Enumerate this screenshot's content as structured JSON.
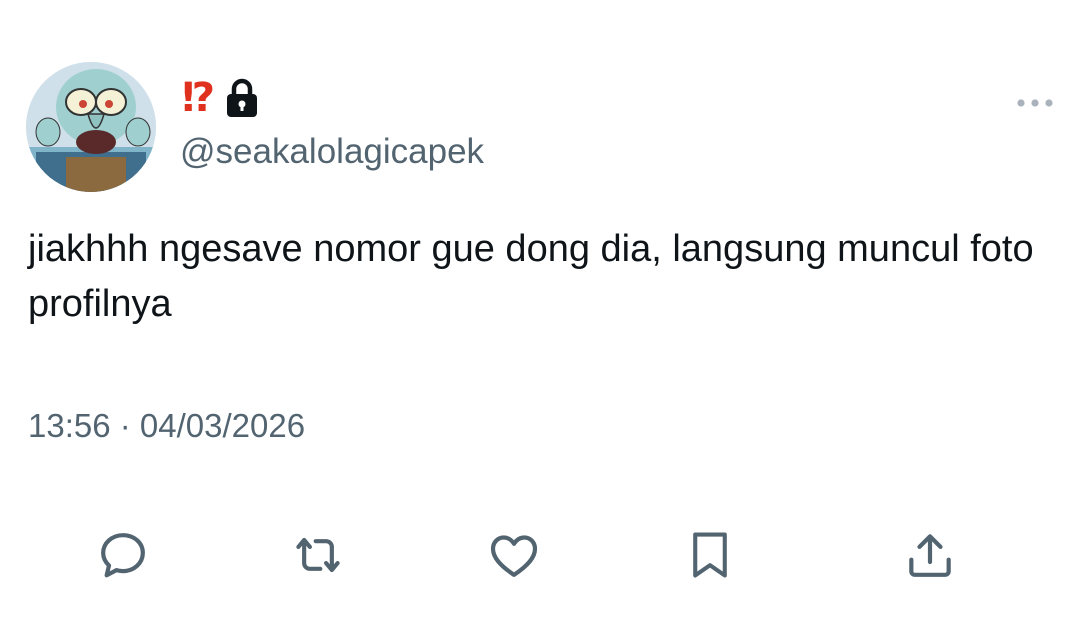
{
  "author": {
    "display_name_emoji": "⁉",
    "handle": "@seakalolagicapek",
    "avatar_description": "squidward-cartoon-avatar",
    "locked_icon": "lock-icon"
  },
  "tweet": {
    "text": "jiakhhh ngesave nomor gue dong dia, langsung muncul foto profilnya",
    "timestamp": "13:56 · 04/03/2026"
  },
  "actions": [
    {
      "icon": "reply-icon"
    },
    {
      "icon": "retweet-icon"
    },
    {
      "icon": "like-icon"
    },
    {
      "icon": "bookmark-icon"
    },
    {
      "icon": "share-icon"
    }
  ],
  "colors": {
    "text": "#0f1419",
    "secondary": "#536471",
    "badge_red": "#e0311f"
  }
}
